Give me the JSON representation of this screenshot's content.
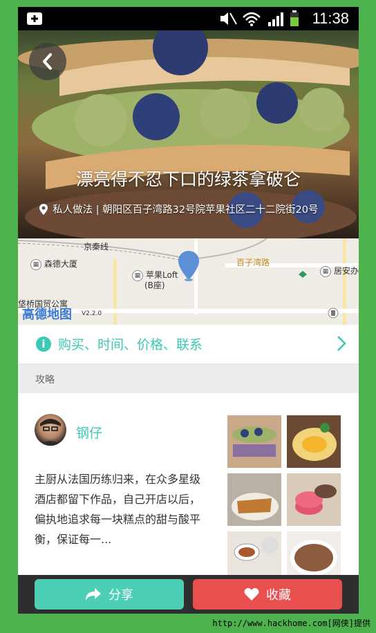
{
  "status_bar": {
    "time": "11:38"
  },
  "hero": {
    "title": "漂亮得不忍下口的绿茶拿破仑",
    "address": "私人做法 | 朝阳区百子湾路32号院苹果社区二十二院街20号"
  },
  "map": {
    "labels": {
      "rail": "京秦线",
      "senda": "森德大厦",
      "apple_loft": "苹果Loft",
      "apple_loft_b": "(B座)",
      "baiziwan": "百子湾路",
      "juan": "居安办",
      "guomao": "垡桥国贸公寓"
    },
    "logo": "高德地图",
    "version": "V2.2.0"
  },
  "info": {
    "label": "购买、时间、价格、联系"
  },
  "section": {
    "label": "攻略"
  },
  "article": {
    "author": "钢仔",
    "summary": "主厨从法国历练归来，在众多星级酒店都留下作品，自己开店以后，偏执地追求每一块糕点的甜与酸平衡，保证每一..."
  },
  "actions": {
    "share": "分享",
    "favorite": "收藏"
  },
  "watermark": "http://www.hackhome.com[网侠]提供",
  "colors": {
    "accent": "#3cc8b4",
    "share": "#4dcfb6",
    "favorite": "#e8504f",
    "frame": "#4db14d"
  }
}
